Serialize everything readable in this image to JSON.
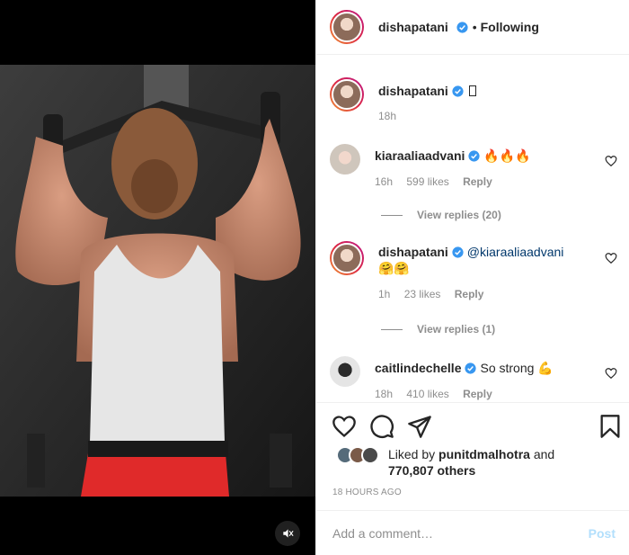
{
  "post": {
    "author": "dishapatani",
    "follow_dot": "•",
    "follow_status": "Following"
  },
  "caption": {
    "user": "dishapatani",
    "text": "",
    "age": "18h"
  },
  "comments": [
    {
      "user": "kiaraaliaadvani",
      "text": "🔥🔥🔥",
      "age": "16h",
      "likes": "599 likes",
      "reply": "Reply",
      "view_replies": "View replies (20)"
    },
    {
      "user": "dishapatani",
      "mention": "@kiaraaliaadvani",
      "text": "🤗🤗",
      "age": "1h",
      "likes": "23 likes",
      "reply": "Reply",
      "view_replies": "View replies (1)"
    },
    {
      "user": "caitlindechelle",
      "text": "So strong 💪",
      "age": "18h",
      "likes": "410 likes",
      "reply": "Reply"
    }
  ],
  "likes": {
    "prefix": "Liked by",
    "user": "punitdmalhotra",
    "and": "and",
    "others": "770,807 others"
  },
  "timestamp": "18 HOURS AGO",
  "composer": {
    "placeholder": "Add a comment…",
    "post_label": "Post"
  },
  "colors": {
    "verified": "#3897f0",
    "link": "#00376b",
    "muted": "#8e8e8e",
    "post_disabled": "#b2dffc"
  },
  "icons": [
    "verified-icon",
    "heart-icon",
    "comment-icon",
    "share-icon",
    "bookmark-icon",
    "mute-icon"
  ]
}
